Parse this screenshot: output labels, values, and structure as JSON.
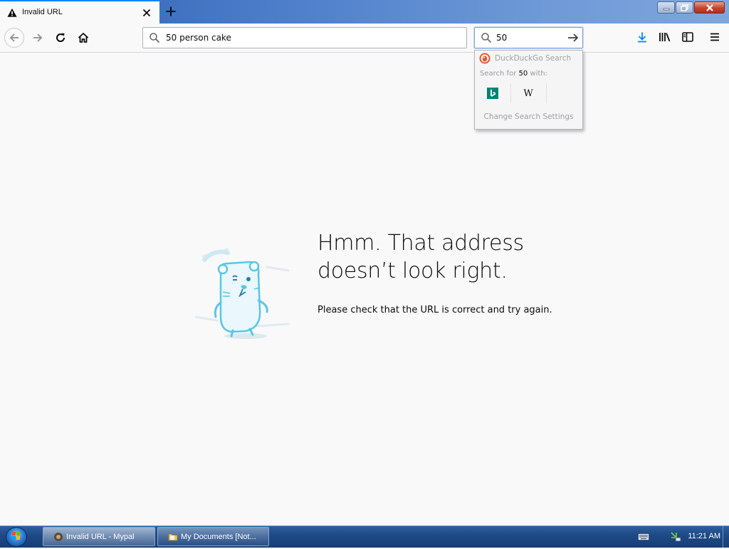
{
  "browser": {
    "tab": {
      "title": "Invalid URL",
      "icon": "warning-icon"
    },
    "newtab_icon": "plus-icon",
    "window_controls": [
      "minimize-icon",
      "restore-icon",
      "close-icon"
    ],
    "nav": {
      "back_icon": "back-arrow-icon",
      "forward_icon": "forward-arrow-icon",
      "reload_icon": "reload-icon",
      "home_icon": "home-icon"
    },
    "urlbar": {
      "value": "50 person cake",
      "icon": "search-icon"
    },
    "searchbar": {
      "value": "50",
      "icon": "search-icon",
      "go_icon": "go-arrow-icon"
    },
    "toolbar_icons": [
      "download-icon",
      "library-icon",
      "sidebar-icon",
      "menu-icon"
    ]
  },
  "search_popup": {
    "engine_name": "DuckDuckGo Search",
    "search_for_prefix": "Search for",
    "search_term": "50",
    "search_for_suffix": "with:",
    "engines": [
      "bing-icon",
      "wikipedia-icon"
    ],
    "wikipedia_label": "W",
    "settings_label": "Change Search Settings"
  },
  "error_page": {
    "title_line1": "Hmm. That address",
    "title_line2": "doesn’t look right.",
    "description": "Please check that the URL is correct and try again."
  },
  "taskbar": {
    "items": [
      {
        "label": "Invalid URL - Mypal",
        "active": true
      },
      {
        "label": "My Documents [Not..."
      }
    ],
    "clock": "11:21 AM"
  },
  "colors": {
    "accent": "#0a84ff",
    "page_bg": "#f9f9fa",
    "taskbar": "#1e4a88",
    "illustration": "#59c6e8"
  }
}
